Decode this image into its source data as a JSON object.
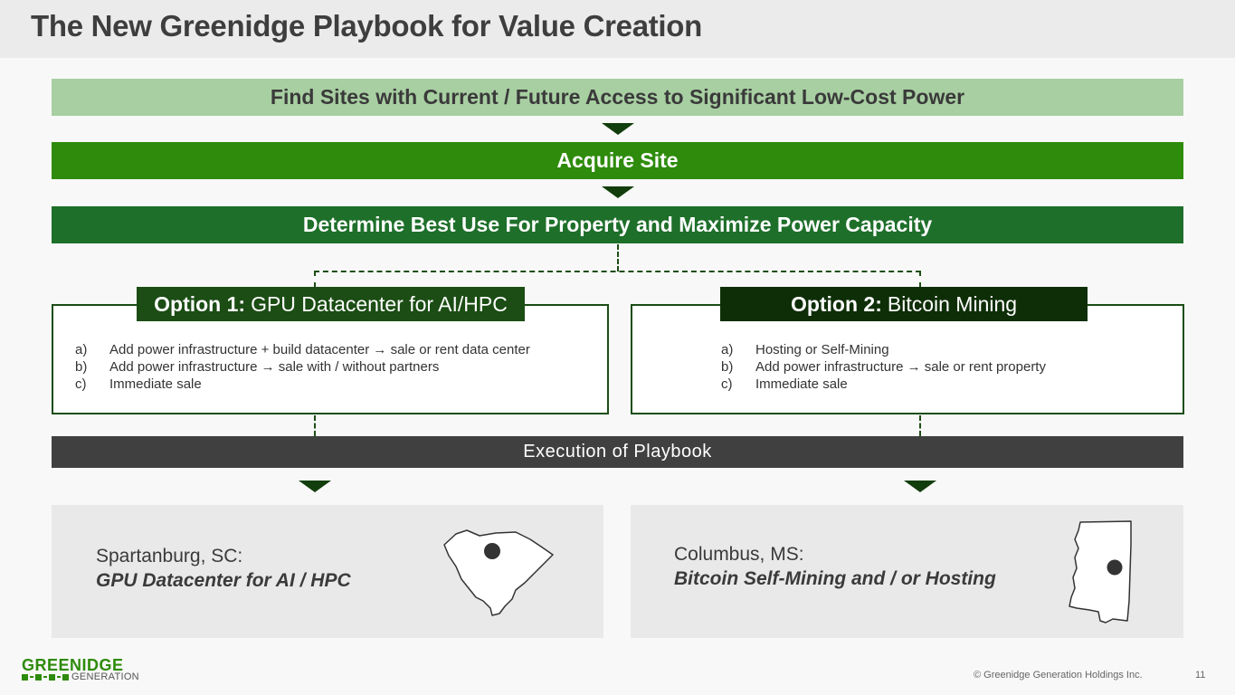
{
  "header": {
    "title": "The New Greenidge Playbook for Value Creation"
  },
  "flow": {
    "step1": "Find Sites with Current / Future Access to Significant Low-Cost Power",
    "step2": "Acquire Site",
    "step3": "Determine Best Use For Property and Maximize Power Capacity"
  },
  "option1": {
    "label": "Option 1:",
    "title": "GPU Datacenter for AI/HPC",
    "items": [
      {
        "marker": "a)",
        "text": "Add power infrastructure + build datacenter → sale or rent data center"
      },
      {
        "marker": "b)",
        "text": "Add power infrastructure → sale with / without partners"
      },
      {
        "marker": "c)",
        "text": "Immediate sale"
      }
    ]
  },
  "option2": {
    "label": "Option 2:",
    "title": "Bitcoin Mining",
    "items": [
      {
        "marker": "a)",
        "text": "Hosting or Self-Mining"
      },
      {
        "marker": "b)",
        "text": "Add power infrastructure → sale or rent property"
      },
      {
        "marker": "c)",
        "text": "Immediate sale"
      }
    ]
  },
  "execution": {
    "label": "Execution of Playbook"
  },
  "sites": [
    {
      "city": "Spartanburg, SC:",
      "use": "GPU Datacenter for AI / HPC",
      "map_icon": "south-carolina-map-icon"
    },
    {
      "city": "Columbus, MS:",
      "use": "Bitcoin Self-Mining and / or Hosting",
      "map_icon": "mississippi-map-icon"
    }
  ],
  "footer": {
    "logo_top": "GREENIDGE",
    "logo_bottom": "GENERATION",
    "copyright": "© Greenidge Generation Holdings Inc.",
    "page": "11"
  },
  "colors": {
    "light_green": "#a8cfa2",
    "bright_green": "#2e8b0b",
    "forest_green": "#1e6f2a",
    "dark_green": "#0e2e07",
    "execution_gray": "#404040"
  }
}
